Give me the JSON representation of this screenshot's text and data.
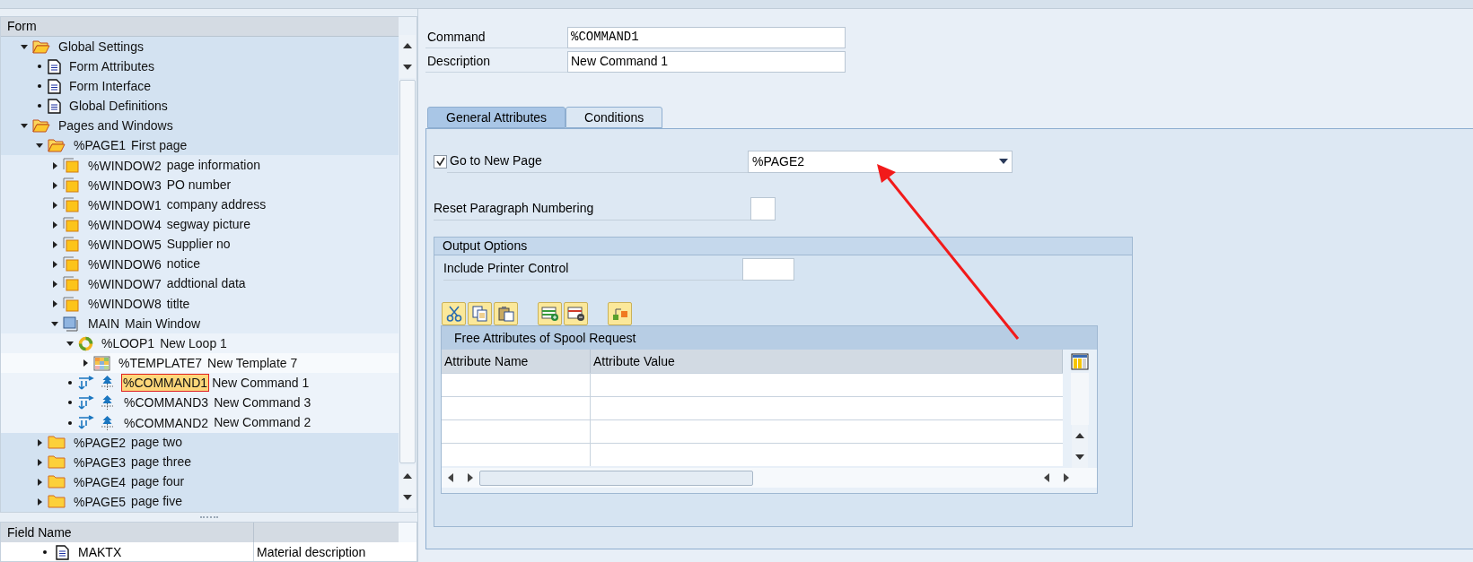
{
  "tree": {
    "header": "Form",
    "nodes": [
      {
        "kind": "folder-open",
        "id": "Global Settings",
        "expanded": true,
        "selected": false,
        "children": [
          {
            "kind": "document",
            "id": "Form Attributes",
            "selected": false
          },
          {
            "kind": "document",
            "id": "Form Interface",
            "selected": false
          },
          {
            "kind": "document",
            "id": "Global Definitions",
            "selected": false
          }
        ]
      },
      {
        "kind": "folder-open",
        "id": "Pages and Windows",
        "expanded": true,
        "selected": false,
        "children": [
          {
            "kind": "folder-open",
            "id": "%PAGE1",
            "desc": "First page",
            "expanded": true,
            "selected": false,
            "children": [
              {
                "kind": "window",
                "id": "%WINDOW2",
                "desc": "page information",
                "expanded": false,
                "selected": false
              },
              {
                "kind": "window",
                "id": "%WINDOW3",
                "desc": "PO number",
                "expanded": false,
                "selected": false
              },
              {
                "kind": "window",
                "id": "%WINDOW1",
                "desc": "company address",
                "expanded": false,
                "selected": false
              },
              {
                "kind": "window",
                "id": "%WINDOW4",
                "desc": "segway picture",
                "expanded": false,
                "selected": false
              },
              {
                "kind": "window",
                "id": "%WINDOW5",
                "desc": "Supplier no",
                "expanded": false,
                "selected": false
              },
              {
                "kind": "window",
                "id": "%WINDOW6",
                "desc": "notice",
                "expanded": false,
                "selected": false
              },
              {
                "kind": "window",
                "id": "%WINDOW7",
                "desc": "addtional data",
                "expanded": false,
                "selected": false
              },
              {
                "kind": "window",
                "id": "%WINDOW8",
                "desc": "titlte",
                "expanded": false,
                "selected": false
              },
              {
                "kind": "main-window",
                "id": "MAIN",
                "desc": "Main Window",
                "expanded": true,
                "selected": false,
                "children": [
                  {
                    "kind": "loop",
                    "id": "%LOOP1",
                    "desc": "New Loop 1",
                    "expanded": true,
                    "selected": false,
                    "children": [
                      {
                        "kind": "template",
                        "id": "%TEMPLATE7",
                        "desc": "New Template 7",
                        "expanded": false,
                        "selected": false
                      }
                    ]
                  },
                  {
                    "kind": "command",
                    "id": "%COMMAND1",
                    "desc": "New Command 1",
                    "selected": true
                  },
                  {
                    "kind": "command",
                    "id": "%COMMAND3",
                    "desc": "New Command 3",
                    "selected": false
                  },
                  {
                    "kind": "command",
                    "id": "%COMMAND2",
                    "desc": "New Command 2",
                    "selected": false
                  }
                ]
              }
            ]
          },
          {
            "kind": "folder",
            "id": "%PAGE2",
            "desc": "page two",
            "expanded": false,
            "selected": false
          },
          {
            "kind": "folder",
            "id": "%PAGE3",
            "desc": "page three",
            "expanded": false,
            "selected": false
          },
          {
            "kind": "folder",
            "id": "%PAGE4",
            "desc": "page four",
            "expanded": false,
            "selected": false
          },
          {
            "kind": "folder",
            "id": "%PAGE5",
            "desc": "page five",
            "expanded": false,
            "selected": false
          }
        ]
      }
    ]
  },
  "field_list": {
    "columns": [
      "Field Name"
    ],
    "rows": [
      {
        "name": "MAKTX",
        "description": "Material description"
      }
    ]
  },
  "header_fields": [
    {
      "label": "Command",
      "value": "%COMMAND1",
      "kind": "mono"
    },
    {
      "label": "Description",
      "value": "New Command 1",
      "kind": "text"
    }
  ],
  "tabs": [
    {
      "label": "General Attributes",
      "selected": true
    },
    {
      "label": "Conditions",
      "selected": false
    }
  ],
  "general": {
    "go_to_new_page": {
      "label": "Go to New Page",
      "checked": true,
      "value": "%PAGE2"
    },
    "reset_numbering": {
      "label": "Reset Paragraph Numbering",
      "checked": false
    },
    "output_options": {
      "title": "Output Options",
      "printer_control_label": "Include Printer Control",
      "table": {
        "title": "Free Attributes of Spool Request",
        "columns": [
          "Attribute Name",
          "Attribute Value"
        ]
      }
    }
  }
}
